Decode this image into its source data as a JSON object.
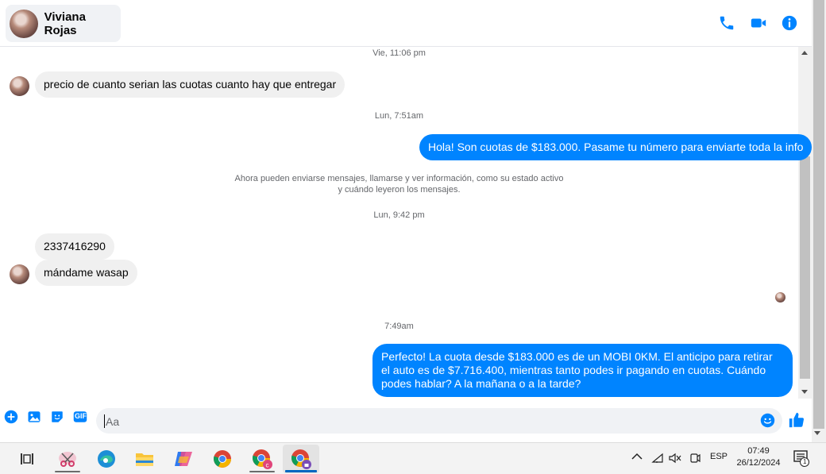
{
  "header": {
    "contact_name": "Viviana Rojas",
    "icons": [
      "phone-icon",
      "video-icon",
      "info-icon"
    ]
  },
  "messages": {
    "ts1": "Vie, 11:06 pm",
    "m1": "precio  de cuanto serian las cuotas  cuanto  hay que entregar",
    "ts2": "Lun, 7:51am",
    "m2": "Hola! Son cuotas de $183.000. Pasame tu número para enviarte toda la info",
    "info_line1": "Ahora pueden enviarse mensajes, llamarse y ver información, como su estado activo",
    "info_line2": "y cuándo leyeron los mensajes.",
    "ts3": "Lun, 9:42 pm",
    "m3": "2337416290",
    "m4": "mándame  wasap",
    "ts4": "7:49am",
    "m5": "Perfecto! La cuota desde $183.000 es de un MOBI 0KM. El anticipo para retirar el auto es de $7.716.400, mientras tanto podes ir pagando en cuotas. Cuándo podes hablar? A la mañana o a la tarde?"
  },
  "composer": {
    "placeholder": "Aa",
    "icons": [
      "plus-icon",
      "image-icon",
      "sticker-icon",
      "gif-icon",
      "emoji-icon",
      "like-icon"
    ],
    "gif_label": "GIF"
  },
  "taskbar": {
    "apps": [
      "task-view",
      "snipping-tool",
      "edge",
      "file-explorer",
      "copilot",
      "chrome",
      "chrome-profile-c",
      "chrome-profile-active"
    ],
    "lang": "ESP",
    "time": "07:49",
    "date": "26/12/2024",
    "notif_count": "1"
  },
  "colors": {
    "accent": "#0084ff",
    "incoming_bubble": "#f0f0f0",
    "taskbar": "#f3f3f3"
  }
}
